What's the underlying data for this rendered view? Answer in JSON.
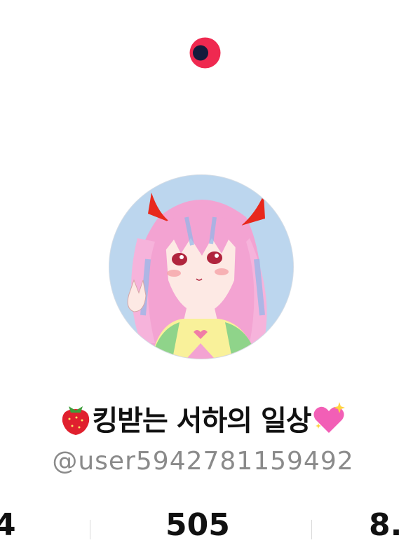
{
  "profile": {
    "display_name": "킹받는 서하의 일상",
    "leading_emoji": "strawberry-emoji",
    "trailing_emoji": "sparkling-heart-emoji",
    "handle": "@user5942781159492"
  },
  "stats": {
    "left_partial": "4",
    "center": "505",
    "right_partial": "8."
  },
  "colors": {
    "logo_red": "#ef2950",
    "logo_navy": "#141b3c",
    "avatar_bg": "#bcd6ee",
    "hair_pink": "#f3a3d2",
    "horn_red": "#e8281c"
  }
}
